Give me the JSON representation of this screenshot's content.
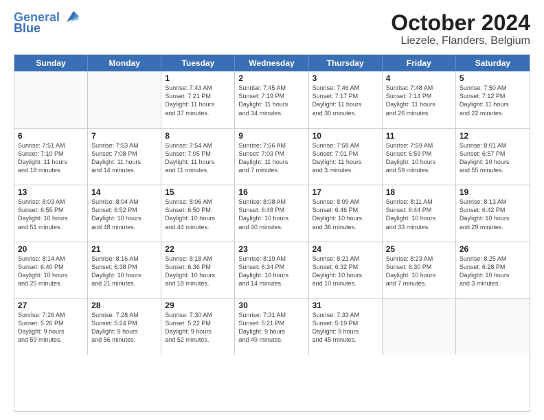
{
  "header": {
    "logo_line1": "General",
    "logo_line2": "Blue",
    "title": "October 2024",
    "subtitle": "Liezele, Flanders, Belgium"
  },
  "calendar": {
    "days_of_week": [
      "Sunday",
      "Monday",
      "Tuesday",
      "Wednesday",
      "Thursday",
      "Friday",
      "Saturday"
    ],
    "rows": [
      [
        {
          "day": "",
          "text": "",
          "empty": true
        },
        {
          "day": "",
          "text": "",
          "empty": true
        },
        {
          "day": "1",
          "text": "Sunrise: 7:43 AM\nSunset: 7:21 PM\nDaylight: 11 hours\nand 37 minutes.",
          "empty": false
        },
        {
          "day": "2",
          "text": "Sunrise: 7:45 AM\nSunset: 7:19 PM\nDaylight: 11 hours\nand 34 minutes.",
          "empty": false
        },
        {
          "day": "3",
          "text": "Sunrise: 7:46 AM\nSunset: 7:17 PM\nDaylight: 11 hours\nand 30 minutes.",
          "empty": false
        },
        {
          "day": "4",
          "text": "Sunrise: 7:48 AM\nSunset: 7:14 PM\nDaylight: 11 hours\nand 26 minutes.",
          "empty": false
        },
        {
          "day": "5",
          "text": "Sunrise: 7:50 AM\nSunset: 7:12 PM\nDaylight: 11 hours\nand 22 minutes.",
          "empty": false
        }
      ],
      [
        {
          "day": "6",
          "text": "Sunrise: 7:51 AM\nSunset: 7:10 PM\nDaylight: 11 hours\nand 18 minutes.",
          "empty": false
        },
        {
          "day": "7",
          "text": "Sunrise: 7:53 AM\nSunset: 7:08 PM\nDaylight: 11 hours\nand 14 minutes.",
          "empty": false
        },
        {
          "day": "8",
          "text": "Sunrise: 7:54 AM\nSunset: 7:05 PM\nDaylight: 11 hours\nand 11 minutes.",
          "empty": false
        },
        {
          "day": "9",
          "text": "Sunrise: 7:56 AM\nSunset: 7:03 PM\nDaylight: 11 hours\nand 7 minutes.",
          "empty": false
        },
        {
          "day": "10",
          "text": "Sunrise: 7:58 AM\nSunset: 7:01 PM\nDaylight: 11 hours\nand 3 minutes.",
          "empty": false
        },
        {
          "day": "11",
          "text": "Sunrise: 7:59 AM\nSunset: 6:59 PM\nDaylight: 10 hours\nand 59 minutes.",
          "empty": false
        },
        {
          "day": "12",
          "text": "Sunrise: 8:01 AM\nSunset: 6:57 PM\nDaylight: 10 hours\nand 55 minutes.",
          "empty": false
        }
      ],
      [
        {
          "day": "13",
          "text": "Sunrise: 8:03 AM\nSunset: 6:55 PM\nDaylight: 10 hours\nand 51 minutes.",
          "empty": false
        },
        {
          "day": "14",
          "text": "Sunrise: 8:04 AM\nSunset: 6:52 PM\nDaylight: 10 hours\nand 48 minutes.",
          "empty": false
        },
        {
          "day": "15",
          "text": "Sunrise: 8:06 AM\nSunset: 6:50 PM\nDaylight: 10 hours\nand 44 minutes.",
          "empty": false
        },
        {
          "day": "16",
          "text": "Sunrise: 8:08 AM\nSunset: 6:48 PM\nDaylight: 10 hours\nand 40 minutes.",
          "empty": false
        },
        {
          "day": "17",
          "text": "Sunrise: 8:09 AM\nSunset: 6:46 PM\nDaylight: 10 hours\nand 36 minutes.",
          "empty": false
        },
        {
          "day": "18",
          "text": "Sunrise: 8:11 AM\nSunset: 6:44 PM\nDaylight: 10 hours\nand 33 minutes.",
          "empty": false
        },
        {
          "day": "19",
          "text": "Sunrise: 8:13 AM\nSunset: 6:42 PM\nDaylight: 10 hours\nand 29 minutes.",
          "empty": false
        }
      ],
      [
        {
          "day": "20",
          "text": "Sunrise: 8:14 AM\nSunset: 6:40 PM\nDaylight: 10 hours\nand 25 minutes.",
          "empty": false
        },
        {
          "day": "21",
          "text": "Sunrise: 8:16 AM\nSunset: 6:38 PM\nDaylight: 10 hours\nand 21 minutes.",
          "empty": false
        },
        {
          "day": "22",
          "text": "Sunrise: 8:18 AM\nSunset: 6:36 PM\nDaylight: 10 hours\nand 18 minutes.",
          "empty": false
        },
        {
          "day": "23",
          "text": "Sunrise: 8:19 AM\nSunset: 6:34 PM\nDaylight: 10 hours\nand 14 minutes.",
          "empty": false
        },
        {
          "day": "24",
          "text": "Sunrise: 8:21 AM\nSunset: 6:32 PM\nDaylight: 10 hours\nand 10 minutes.",
          "empty": false
        },
        {
          "day": "25",
          "text": "Sunrise: 8:23 AM\nSunset: 6:30 PM\nDaylight: 10 hours\nand 7 minutes.",
          "empty": false
        },
        {
          "day": "26",
          "text": "Sunrise: 8:25 AM\nSunset: 6:28 PM\nDaylight: 10 hours\nand 3 minutes.",
          "empty": false
        }
      ],
      [
        {
          "day": "27",
          "text": "Sunrise: 7:26 AM\nSunset: 5:26 PM\nDaylight: 9 hours\nand 59 minutes.",
          "empty": false
        },
        {
          "day": "28",
          "text": "Sunrise: 7:28 AM\nSunset: 5:24 PM\nDaylight: 9 hours\nand 56 minutes.",
          "empty": false
        },
        {
          "day": "29",
          "text": "Sunrise: 7:30 AM\nSunset: 5:22 PM\nDaylight: 9 hours\nand 52 minutes.",
          "empty": false
        },
        {
          "day": "30",
          "text": "Sunrise: 7:31 AM\nSunset: 5:21 PM\nDaylight: 9 hours\nand 49 minutes.",
          "empty": false
        },
        {
          "day": "31",
          "text": "Sunrise: 7:33 AM\nSunset: 5:19 PM\nDaylight: 9 hours\nand 45 minutes.",
          "empty": false
        },
        {
          "day": "",
          "text": "",
          "empty": true
        },
        {
          "day": "",
          "text": "",
          "empty": true
        }
      ]
    ]
  }
}
